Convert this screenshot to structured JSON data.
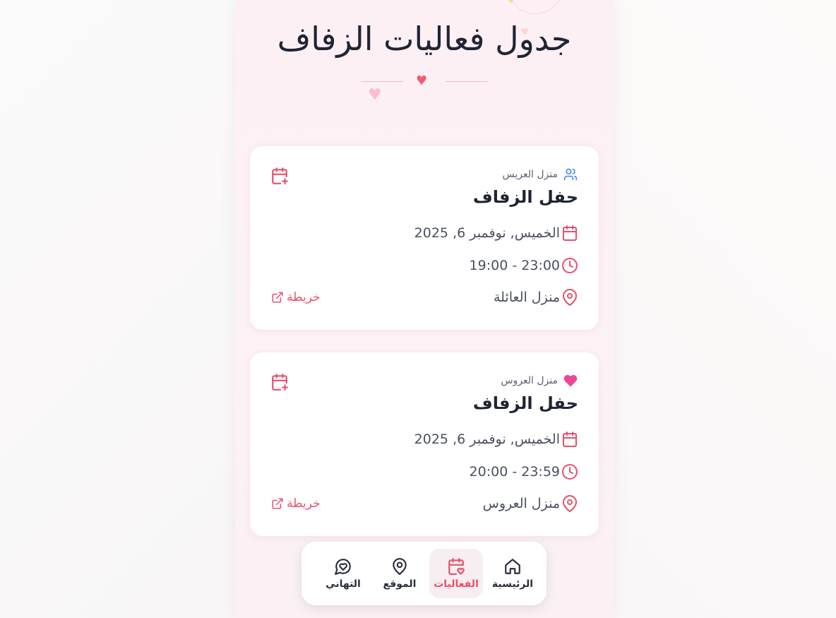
{
  "header": {
    "title": "جدول فعاليات الزفاف"
  },
  "events": [
    {
      "host": "منزل العريس",
      "host_icon": "users-icon",
      "title": "حفل الزفاف",
      "date": "الخميس, نوفمبر 6, 2025",
      "time": "19:00 - 23:00",
      "place": "منزل العائلة",
      "map_label": "خريطة"
    },
    {
      "host": "منزل العروس",
      "host_icon": "heart-icon",
      "title": "حفل الزفاف",
      "date": "الخميس, نوفمبر 6, 2025",
      "time": "20:00 - 23:59",
      "place": "منزل العروس",
      "map_label": "خريطة"
    }
  ],
  "nav": {
    "items": [
      {
        "label": "الرئيسية",
        "icon": "home-icon",
        "active": false
      },
      {
        "label": "الفعاليات",
        "icon": "calendar-heart-icon",
        "active": true
      },
      {
        "label": "الموقع",
        "icon": "map-pin-icon",
        "active": false
      },
      {
        "label": "التهاني",
        "icon": "message-heart-icon",
        "active": false
      }
    ]
  },
  "colors": {
    "accent": "#e8506b",
    "title": "#1f2433",
    "host_icon_blue": "#3b82f6",
    "host_icon_pink": "#ec4899"
  }
}
